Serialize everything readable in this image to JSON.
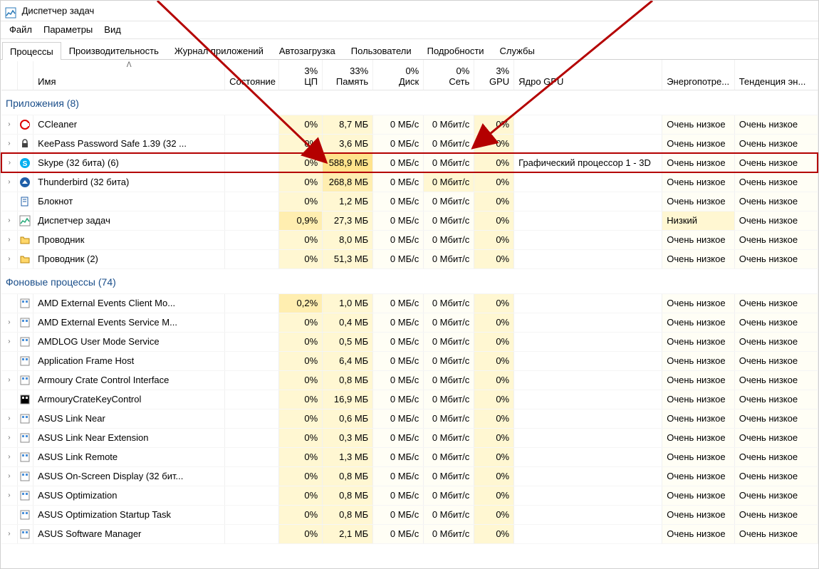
{
  "window": {
    "title": "Диспетчер задач"
  },
  "menu": [
    "Файл",
    "Параметры",
    "Вид"
  ],
  "tabs": [
    {
      "label": "Процессы",
      "active": true
    },
    {
      "label": "Производительность"
    },
    {
      "label": "Журнал приложений"
    },
    {
      "label": "Автозагрузка"
    },
    {
      "label": "Пользователи"
    },
    {
      "label": "Подробности"
    },
    {
      "label": "Службы"
    }
  ],
  "columns": [
    {
      "key": "name",
      "label": "Имя",
      "align": "left",
      "sort": true
    },
    {
      "key": "status",
      "label": "Состояние",
      "align": "left"
    },
    {
      "key": "cpu",
      "label": "ЦП",
      "pct": "3%",
      "heat": 1
    },
    {
      "key": "mem",
      "label": "Память",
      "pct": "33%",
      "heat": 2
    },
    {
      "key": "disk",
      "label": "Диск",
      "pct": "0%",
      "heat": 0
    },
    {
      "key": "net",
      "label": "Сеть",
      "pct": "0%",
      "heat": 0
    },
    {
      "key": "gpu",
      "label": "GPU",
      "pct": "3%",
      "heat": 1
    },
    {
      "key": "gpucore",
      "label": "Ядро GPU",
      "align": "left"
    },
    {
      "key": "energy",
      "label": "Энергопотре...",
      "align": "left"
    },
    {
      "key": "trend",
      "label": "Тенденция эн...",
      "align": "left"
    }
  ],
  "groups": [
    {
      "title": "Приложения (8)",
      "rows": [
        {
          "exp": true,
          "icon": "ccleaner",
          "name": "CCleaner",
          "cpu": "0%",
          "mem": "8,7 МБ",
          "disk": "0 МБ/с",
          "net": "0 Мбит/с",
          "gpu": "0%",
          "gpucore": "",
          "energy": "Очень низкое",
          "trend": "Очень низкое",
          "heat": {
            "cpu": 1,
            "mem": 1,
            "disk": 0,
            "net": 0,
            "gpu": 1
          }
        },
        {
          "exp": true,
          "icon": "keepass",
          "name": "KeePass Password Safe 1.39 (32 ...",
          "cpu": "0%",
          "mem": "3,6 МБ",
          "disk": "0 МБ/с",
          "net": "0 Мбит/с",
          "gpu": "0%",
          "gpucore": "",
          "energy": "Очень низкое",
          "trend": "Очень низкое",
          "heat": {
            "cpu": 1,
            "mem": 1,
            "disk": 0,
            "net": 0,
            "gpu": 1
          }
        },
        {
          "exp": true,
          "icon": "skype",
          "name": "Skype (32 бита) (6)",
          "cpu": "0%",
          "mem": "588,9 МБ",
          "disk": "0 МБ/с",
          "net": "0 Мбит/с",
          "gpu": "0%",
          "gpucore": "Графический процессор 1 - 3D",
          "energy": "Очень низкое",
          "trend": "Очень низкое",
          "heat": {
            "cpu": 1,
            "mem": 3,
            "disk": 0,
            "net": 0,
            "gpu": 1
          },
          "highlight": true
        },
        {
          "exp": true,
          "icon": "thunderbird",
          "name": "Thunderbird (32 бита)",
          "cpu": "0%",
          "mem": "268,8 МБ",
          "disk": "0 МБ/с",
          "net": "0 Мбит/с",
          "gpu": "0%",
          "gpucore": "",
          "energy": "Очень низкое",
          "trend": "Очень низкое",
          "heat": {
            "cpu": 1,
            "mem": 2,
            "disk": 0,
            "net": 1,
            "gpu": 1
          }
        },
        {
          "exp": false,
          "icon": "notepad",
          "name": "Блокнот",
          "cpu": "0%",
          "mem": "1,2 МБ",
          "disk": "0 МБ/с",
          "net": "0 Мбит/с",
          "gpu": "0%",
          "gpucore": "",
          "energy": "Очень низкое",
          "trend": "Очень низкое",
          "heat": {
            "cpu": 1,
            "mem": 1,
            "disk": 0,
            "net": 0,
            "gpu": 1
          }
        },
        {
          "exp": true,
          "icon": "taskmgr",
          "name": "Диспетчер задач",
          "cpu": "0,9%",
          "mem": "27,3 МБ",
          "disk": "0 МБ/с",
          "net": "0 Мбит/с",
          "gpu": "0%",
          "gpucore": "",
          "energy": "Низкий",
          "trend": "Очень низкое",
          "heat": {
            "cpu": 2,
            "mem": 1,
            "disk": 0,
            "net": 0,
            "gpu": 1
          },
          "energyHeat": 1
        },
        {
          "exp": true,
          "icon": "explorer",
          "name": "Проводник",
          "cpu": "0%",
          "mem": "8,0 МБ",
          "disk": "0 МБ/с",
          "net": "0 Мбит/с",
          "gpu": "0%",
          "gpucore": "",
          "energy": "Очень низкое",
          "trend": "Очень низкое",
          "heat": {
            "cpu": 1,
            "mem": 1,
            "disk": 0,
            "net": 0,
            "gpu": 1
          }
        },
        {
          "exp": true,
          "icon": "explorer",
          "name": "Проводник (2)",
          "cpu": "0%",
          "mem": "51,3 МБ",
          "disk": "0 МБ/с",
          "net": "0 Мбит/с",
          "gpu": "0%",
          "gpucore": "",
          "energy": "Очень низкое",
          "trend": "Очень низкое",
          "heat": {
            "cpu": 1,
            "mem": 1,
            "disk": 0,
            "net": 0,
            "gpu": 1
          }
        }
      ]
    },
    {
      "title": "Фоновые процессы (74)",
      "rows": [
        {
          "exp": false,
          "icon": "gen",
          "name": "AMD External Events Client Mo...",
          "cpu": "0,2%",
          "mem": "1,0 МБ",
          "disk": "0 МБ/с",
          "net": "0 Мбит/с",
          "gpu": "0%",
          "energy": "Очень низкое",
          "trend": "Очень низкое",
          "heat": {
            "cpu": 2,
            "mem": 1,
            "disk": 0,
            "net": 0,
            "gpu": 1
          }
        },
        {
          "exp": true,
          "icon": "gen",
          "name": "AMD External Events Service M...",
          "cpu": "0%",
          "mem": "0,4 МБ",
          "disk": "0 МБ/с",
          "net": "0 Мбит/с",
          "gpu": "0%",
          "energy": "Очень низкое",
          "trend": "Очень низкое",
          "heat": {
            "cpu": 1,
            "mem": 1,
            "disk": 0,
            "net": 0,
            "gpu": 1
          }
        },
        {
          "exp": true,
          "icon": "gen",
          "name": "AMDLOG User Mode Service",
          "cpu": "0%",
          "mem": "0,5 МБ",
          "disk": "0 МБ/с",
          "net": "0 Мбит/с",
          "gpu": "0%",
          "energy": "Очень низкое",
          "trend": "Очень низкое",
          "heat": {
            "cpu": 1,
            "mem": 1,
            "disk": 0,
            "net": 0,
            "gpu": 1
          }
        },
        {
          "exp": false,
          "icon": "gen",
          "name": "Application Frame Host",
          "cpu": "0%",
          "mem": "6,4 МБ",
          "disk": "0 МБ/с",
          "net": "0 Мбит/с",
          "gpu": "0%",
          "energy": "Очень низкое",
          "trend": "Очень низкое",
          "heat": {
            "cpu": 1,
            "mem": 1,
            "disk": 0,
            "net": 0,
            "gpu": 1
          }
        },
        {
          "exp": true,
          "icon": "gen",
          "name": "Armoury Crate Control Interface",
          "cpu": "0%",
          "mem": "0,8 МБ",
          "disk": "0 МБ/с",
          "net": "0 Мбит/с",
          "gpu": "0%",
          "energy": "Очень низкое",
          "trend": "Очень низкое",
          "heat": {
            "cpu": 1,
            "mem": 1,
            "disk": 0,
            "net": 0,
            "gpu": 1
          }
        },
        {
          "exp": false,
          "icon": "black",
          "name": "ArmouryCrateKeyControl",
          "cpu": "0%",
          "mem": "16,9 МБ",
          "disk": "0 МБ/с",
          "net": "0 Мбит/с",
          "gpu": "0%",
          "energy": "Очень низкое",
          "trend": "Очень низкое",
          "heat": {
            "cpu": 1,
            "mem": 1,
            "disk": 0,
            "net": 0,
            "gpu": 1
          }
        },
        {
          "exp": true,
          "icon": "gen",
          "name": "ASUS Link Near",
          "cpu": "0%",
          "mem": "0,6 МБ",
          "disk": "0 МБ/с",
          "net": "0 Мбит/с",
          "gpu": "0%",
          "energy": "Очень низкое",
          "trend": "Очень низкое",
          "heat": {
            "cpu": 1,
            "mem": 1,
            "disk": 0,
            "net": 0,
            "gpu": 1
          }
        },
        {
          "exp": true,
          "icon": "gen",
          "name": "ASUS Link Near Extension",
          "cpu": "0%",
          "mem": "0,3 МБ",
          "disk": "0 МБ/с",
          "net": "0 Мбит/с",
          "gpu": "0%",
          "energy": "Очень низкое",
          "trend": "Очень низкое",
          "heat": {
            "cpu": 1,
            "mem": 1,
            "disk": 0,
            "net": 0,
            "gpu": 1
          }
        },
        {
          "exp": true,
          "icon": "gen",
          "name": "ASUS Link Remote",
          "cpu": "0%",
          "mem": "1,3 МБ",
          "disk": "0 МБ/с",
          "net": "0 Мбит/с",
          "gpu": "0%",
          "energy": "Очень низкое",
          "trend": "Очень низкое",
          "heat": {
            "cpu": 1,
            "mem": 1,
            "disk": 0,
            "net": 0,
            "gpu": 1
          }
        },
        {
          "exp": true,
          "icon": "gen",
          "name": "ASUS On-Screen Display (32 бит...",
          "cpu": "0%",
          "mem": "0,8 МБ",
          "disk": "0 МБ/с",
          "net": "0 Мбит/с",
          "gpu": "0%",
          "energy": "Очень низкое",
          "trend": "Очень низкое",
          "heat": {
            "cpu": 1,
            "mem": 1,
            "disk": 0,
            "net": 0,
            "gpu": 1
          }
        },
        {
          "exp": true,
          "icon": "gen",
          "name": "ASUS Optimization",
          "cpu": "0%",
          "mem": "0,8 МБ",
          "disk": "0 МБ/с",
          "net": "0 Мбит/с",
          "gpu": "0%",
          "energy": "Очень низкое",
          "trend": "Очень низкое",
          "heat": {
            "cpu": 1,
            "mem": 1,
            "disk": 0,
            "net": 0,
            "gpu": 1
          }
        },
        {
          "exp": false,
          "icon": "gen",
          "name": "ASUS Optimization Startup Task",
          "cpu": "0%",
          "mem": "0,8 МБ",
          "disk": "0 МБ/с",
          "net": "0 Мбит/с",
          "gpu": "0%",
          "energy": "Очень низкое",
          "trend": "Очень низкое",
          "heat": {
            "cpu": 1,
            "mem": 1,
            "disk": 0,
            "net": 0,
            "gpu": 1
          }
        },
        {
          "exp": true,
          "icon": "gen",
          "name": "ASUS Software Manager",
          "cpu": "0%",
          "mem": "2,1 МБ",
          "disk": "0 МБ/с",
          "net": "0 Мбит/с",
          "gpu": "0%",
          "energy": "Очень низкое",
          "trend": "Очень низкое",
          "heat": {
            "cpu": 1,
            "mem": 1,
            "disk": 0,
            "net": 0,
            "gpu": 1
          }
        }
      ]
    }
  ],
  "icons": {
    "ccleaner": {
      "bg": "#fff",
      "fg": "#d00",
      "shape": "C"
    },
    "keepass": {
      "bg": "#fff",
      "fg": "#444",
      "shape": "lock"
    },
    "skype": {
      "bg": "#00aff0",
      "fg": "#fff",
      "shape": "S"
    },
    "thunderbird": {
      "bg": "#fff",
      "fg": "#1f5fa8",
      "shape": "tb"
    },
    "notepad": {
      "bg": "#fff",
      "fg": "#1f5fa8",
      "shape": "page"
    },
    "taskmgr": {
      "bg": "#fff",
      "fg": "#2a7",
      "shape": "chart"
    },
    "explorer": {
      "bg": "#ffd76a",
      "fg": "#b8860b",
      "shape": "folder"
    },
    "gen": {
      "bg": "#fff",
      "fg": "#4a90d9",
      "shape": "app"
    },
    "black": {
      "bg": "#000",
      "fg": "#fff",
      "shape": "app"
    }
  }
}
